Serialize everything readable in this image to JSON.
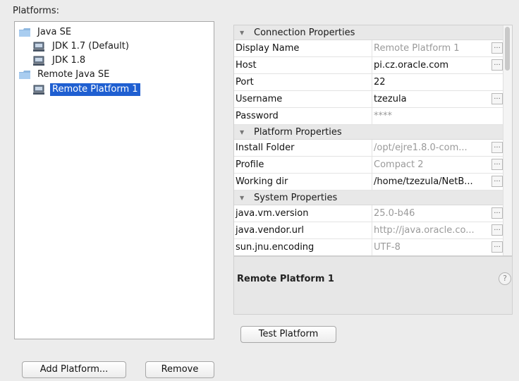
{
  "platforms_label": "Platforms:",
  "tree": {
    "groups": [
      {
        "label": "Java SE",
        "children": [
          {
            "label": "JDK 1.7 (Default)"
          },
          {
            "label": "JDK 1.8"
          }
        ]
      },
      {
        "label": "Remote Java SE",
        "children": [
          {
            "label": "Remote Platform 1",
            "selected": true
          }
        ]
      }
    ]
  },
  "properties": {
    "connection": {
      "title": "Connection Properties",
      "rows": [
        {
          "name": "Display Name",
          "value": "Remote Platform 1",
          "readonly": true
        },
        {
          "name": "Host",
          "value": "pi.cz.oracle.com"
        },
        {
          "name": "Port",
          "value": "22"
        },
        {
          "name": "Username",
          "value": "tzezula"
        },
        {
          "name": "Password",
          "value": "****"
        }
      ]
    },
    "platform": {
      "title": "Platform Properties",
      "rows": [
        {
          "name": "Install Folder",
          "value": "/opt/ejre1.8.0-com...",
          "readonly": true
        },
        {
          "name": "Profile",
          "value": "Compact 2",
          "readonly": true
        },
        {
          "name": "Working dir",
          "value": "/home/tzezula/NetB..."
        }
      ]
    },
    "system": {
      "title": "System Properties",
      "rows": [
        {
          "name": "java.vm.version",
          "value": "25.0-b46",
          "readonly": true
        },
        {
          "name": "java.vendor.url",
          "value": "http://java.oracle.co...",
          "readonly": true
        },
        {
          "name": "sun.jnu.encoding",
          "value": "UTF-8",
          "readonly": true
        }
      ]
    },
    "ellipsis": "..."
  },
  "description": {
    "title": "Remote Platform 1",
    "help": "?"
  },
  "buttons": {
    "test_platform": "Test Platform",
    "add_platform": "Add Platform...",
    "remove": "Remove"
  },
  "icons": [
    "folder-icon",
    "jdk-icon",
    "help-icon",
    "expand-arrow-icon",
    "ellipsis-button"
  ],
  "colors": {
    "selection": "#1f5fd1",
    "readonly_text": "#9a9a9a"
  }
}
